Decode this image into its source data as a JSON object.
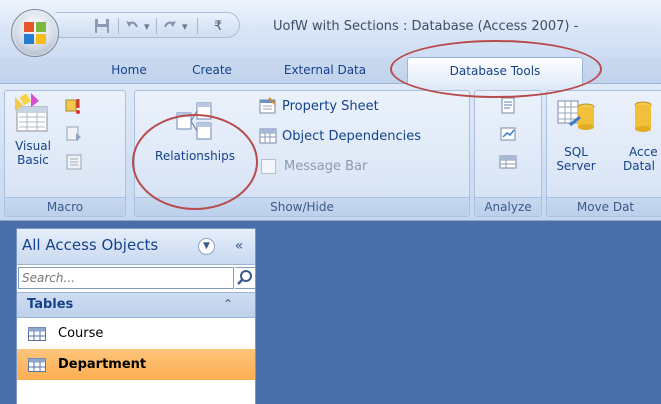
{
  "window": {
    "title": "UofW with Sections : Database (Access 2007) - "
  },
  "tabs": [
    {
      "label": "Home"
    },
    {
      "label": "Create"
    },
    {
      "label": "External Data"
    },
    {
      "label": "Database Tools"
    }
  ],
  "ribbon": {
    "macro": {
      "visual_basic_line1": "Visual",
      "visual_basic_line2": "Basic",
      "label": "Macro"
    },
    "show_hide": {
      "relationships": "Relationships",
      "property_sheet": "Property Sheet",
      "object_dependencies": "Object Dependencies",
      "message_bar": "Message Bar",
      "label": "Show/Hide"
    },
    "analyze": {
      "label": "Analyze"
    },
    "move_data": {
      "sql_server_line1": "SQL",
      "sql_server_line2": "Server",
      "access_db_line1": "Acce",
      "access_db_line2": "Datal",
      "label": "Move Dat"
    }
  },
  "nav_pane": {
    "title": "All Access Objects",
    "collapse_glyph": "«",
    "search_placeholder": "Search...",
    "section": "Tables",
    "section_chevron": "⌃",
    "items": [
      {
        "label": "Course",
        "selected": false
      },
      {
        "label": "Department",
        "selected": true
      }
    ]
  },
  "colors": {
    "accent_circle": "#b84c4c",
    "selected_row": "#fcae52",
    "workspace": "#4a6ea9"
  }
}
